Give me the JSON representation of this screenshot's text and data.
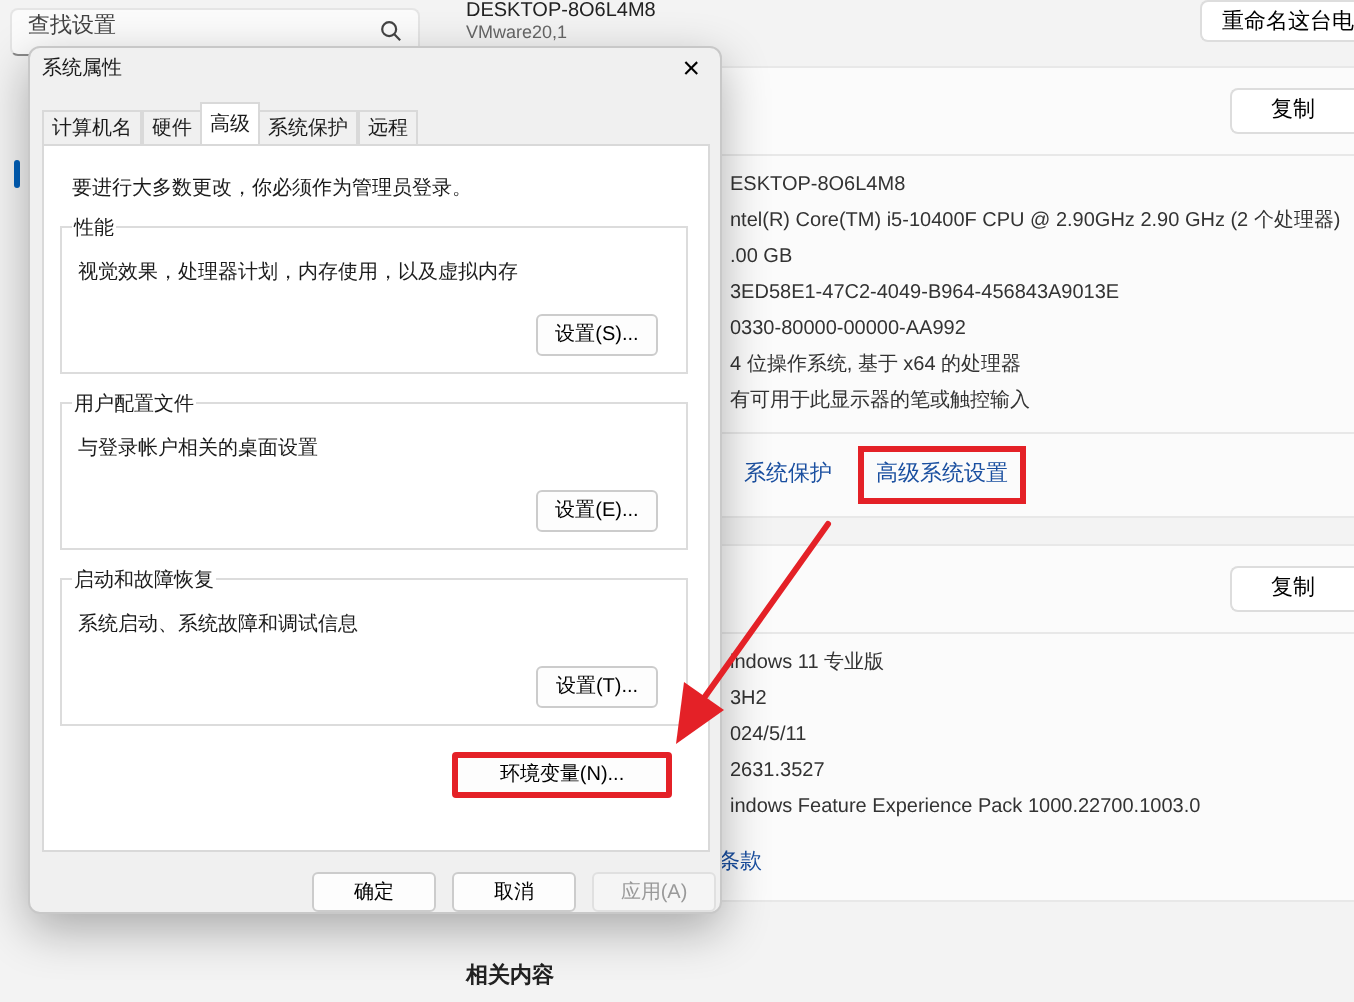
{
  "sidebar": {
    "search": {
      "placeholder": "查找设置"
    }
  },
  "device": {
    "name": "DESKTOP-8O6L4M8",
    "model": "VMware20,1",
    "rename_button": "重命名这台电"
  },
  "device_specs": {
    "copy_button": "复制",
    "values": [
      "ESKTOP-8O6L4M8",
      "ntel(R) Core(TM) i5-10400F CPU @ 2.90GHz   2.90 GHz  (2 个处理器)",
      ".00 GB",
      "3ED58E1-47C2-4049-B964-456843A9013E",
      "0330-80000-00000-AA992",
      "4 位操作系统, 基于 x64 的处理器",
      "有可用于此显示器的笔或触控输入"
    ],
    "links": [
      {
        "label": "系统保护",
        "highlighted": false
      },
      {
        "label": "高级系统设置",
        "highlighted": true
      }
    ]
  },
  "windows_specs": {
    "copy_button": "复制",
    "values": [
      "indows 11 专业版",
      "3H2",
      "024/5/11",
      "2631.3527",
      "indows Feature Experience Pack 1000.22700.1003.0"
    ],
    "link": "条款"
  },
  "related_heading": "相关内容",
  "dialog": {
    "title": "系统属性",
    "close": "×",
    "tabs": [
      {
        "label": "计算机名",
        "selected": false
      },
      {
        "label": "硬件",
        "selected": false
      },
      {
        "label": "高级",
        "selected": true
      },
      {
        "label": "系统保护",
        "selected": false
      },
      {
        "label": "远程",
        "selected": false
      }
    ],
    "notice": "要进行大多数更改，你必须作为管理员登录。",
    "groups": [
      {
        "title": "性能",
        "description": "视觉效果，处理器计划，内存使用，以及虚拟内存",
        "button": "设置(S)..."
      },
      {
        "title": "用户配置文件",
        "description": "与登录帐户相关的桌面设置",
        "button": "设置(E)..."
      },
      {
        "title": "启动和故障恢复",
        "description": "系统启动、系统故障和调试信息",
        "button": "设置(T)..."
      }
    ],
    "env_button": {
      "label": "环境变量(N)...",
      "highlighted": true
    },
    "buttons": [
      {
        "label": "确定",
        "disabled": false
      },
      {
        "label": "取消",
        "disabled": false
      },
      {
        "label": "应用(A)",
        "disabled": true
      }
    ]
  }
}
